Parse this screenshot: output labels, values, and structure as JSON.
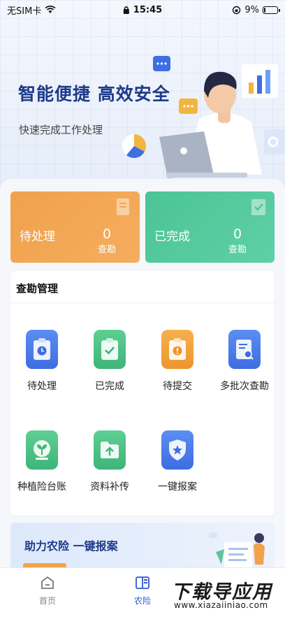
{
  "status_bar": {
    "carrier": "无SIM卡",
    "time": "15:45",
    "battery": "9%",
    "battery_level": 0.09
  },
  "hero": {
    "title": "智能便捷 高效安全",
    "subtitle": "快速完成工作处理"
  },
  "stats": [
    {
      "label": "待处理",
      "count": "0",
      "unit": "查勘",
      "color": "#f0a24c"
    },
    {
      "label": "已完成",
      "count": "0",
      "unit": "查勘",
      "color": "#4bc495"
    }
  ],
  "inspection": {
    "title": "查勘管理",
    "items": [
      {
        "label": "待处理",
        "icon": "clipboard-clock-icon"
      },
      {
        "label": "已完成",
        "icon": "clipboard-check-icon"
      },
      {
        "label": "待提交",
        "icon": "clipboard-alert-icon"
      },
      {
        "label": "多批次查勘",
        "icon": "document-search-icon"
      },
      {
        "label": "种植险台账",
        "icon": "sprout-icon"
      },
      {
        "label": "资料补传",
        "icon": "folder-upload-icon"
      },
      {
        "label": "一键报案",
        "icon": "shield-star-icon"
      }
    ]
  },
  "promo": {
    "title": "助力农险 一键报案"
  },
  "tabbar": {
    "home": "首页",
    "agri": "农险"
  },
  "watermark": {
    "main": "下载导应用",
    "sub": "www.xiazaiiniao.com"
  },
  "colors": {
    "primary": "#2e5ad1",
    "pending": "#f0a24c",
    "done": "#4bc495"
  }
}
